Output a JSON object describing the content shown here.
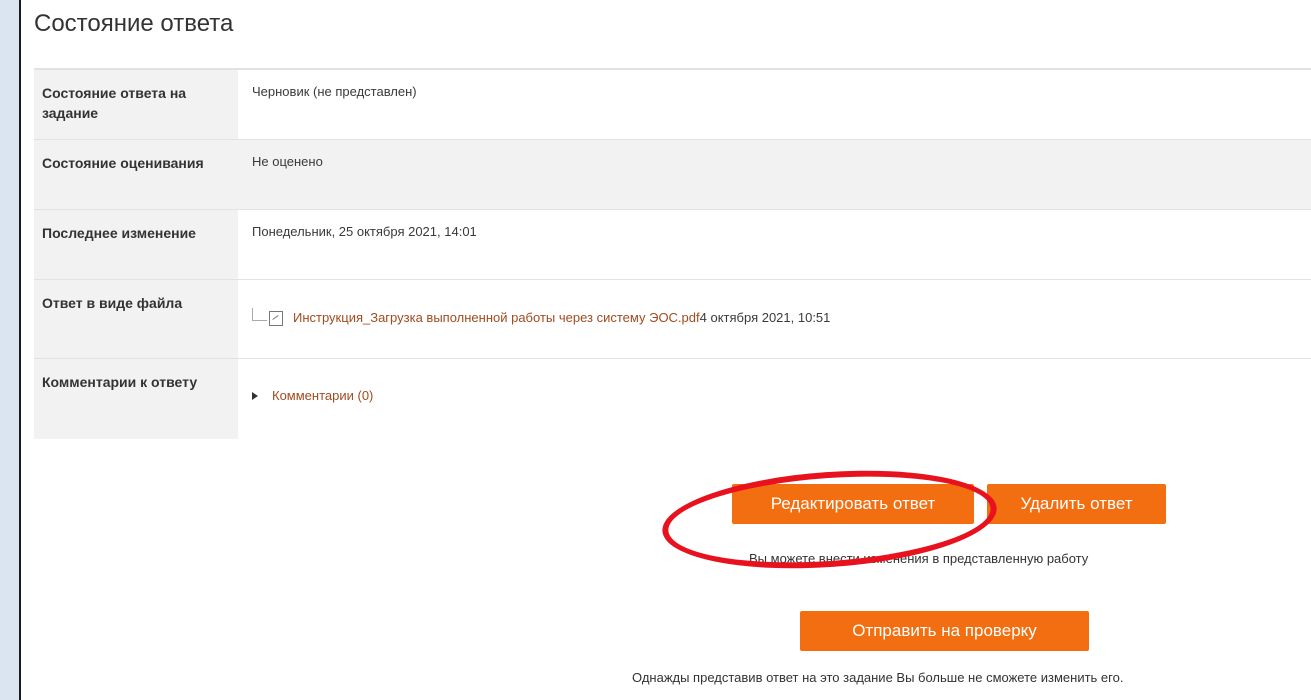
{
  "title": "Состояние ответа",
  "rows": {
    "submission_status": {
      "label": "Состояние ответа на задание",
      "value": "Черновик (не представлен)"
    },
    "grading_status": {
      "label": "Состояние оценивания",
      "value": "Не оценено"
    },
    "last_modified": {
      "label": "Последнее изменение",
      "value": "Понедельник, 25 октября 2021, 14:01"
    },
    "file_submission": {
      "label": "Ответ в виде файла",
      "file_name": "Инструкция_Загрузка выполненной работы через систему ЭОС.pdf",
      "file_date": "4 октября 2021, 10:51"
    },
    "comments": {
      "label": "Комментарии к ответу",
      "link": "Комментарии (0)"
    }
  },
  "buttons": {
    "edit": "Редактировать ответ",
    "delete": "Удалить ответ",
    "submit": "Отправить на проверку"
  },
  "notes": {
    "edit": "Вы можете внести изменения в представленную работу",
    "submit": "Однажды представив ответ на это задание Вы больше не сможете изменить его."
  },
  "colors": {
    "accent": "#f26e10",
    "link": "#a14b1f",
    "highlight_ellipse": "#e8121f"
  }
}
